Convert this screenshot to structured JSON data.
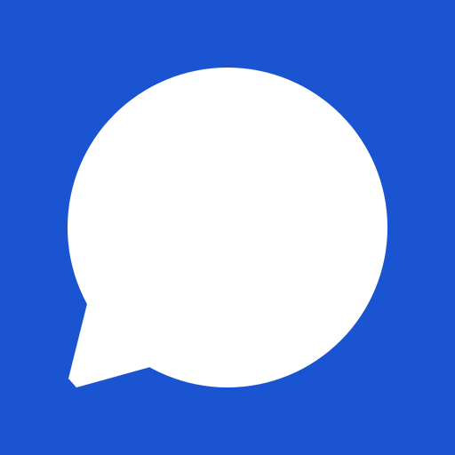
{
  "icon": {
    "name": "chat-bubble-icon",
    "background_color": "#1b54d0",
    "foreground_color": "#ffffff"
  }
}
